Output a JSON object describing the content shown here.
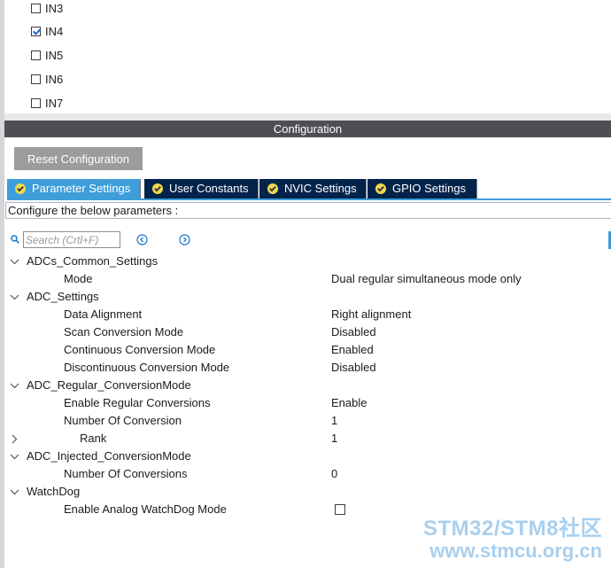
{
  "inputs_panel": {
    "items": [
      {
        "label": "IN3",
        "checked": false
      },
      {
        "label": "IN4",
        "checked": true
      },
      {
        "label": "IN5",
        "checked": false
      },
      {
        "label": "IN6",
        "checked": false
      },
      {
        "label": "IN7",
        "checked": false
      }
    ]
  },
  "config_header": {
    "title": "Configuration"
  },
  "toolbar": {
    "reset_label": "Reset Configuration"
  },
  "tabs": [
    {
      "label": "Parameter Settings",
      "active": true,
      "icon": "check-circle-icon"
    },
    {
      "label": "User Constants",
      "active": false,
      "icon": "check-circle-icon"
    },
    {
      "label": "NVIC Settings",
      "active": false,
      "icon": "check-circle-icon"
    },
    {
      "label": "GPIO Settings",
      "active": false,
      "icon": "check-circle-icon"
    }
  ],
  "configure_hint": "Configure the below parameters :",
  "search": {
    "placeholder": "Search (Crtl+F)",
    "value": ""
  },
  "tree": {
    "groups": [
      {
        "label": "ADCs_Common_Settings",
        "expanded": true,
        "params": [
          {
            "label": "Mode",
            "value": "Dual regular simultaneous mode only"
          }
        ]
      },
      {
        "label": "ADC_Settings",
        "expanded": true,
        "params": [
          {
            "label": "Data Alignment",
            "value": "Right alignment"
          },
          {
            "label": "Scan Conversion Mode",
            "value": "Disabled"
          },
          {
            "label": "Continuous Conversion Mode",
            "value": "Enabled"
          },
          {
            "label": "Discontinuous Conversion Mode",
            "value": "Disabled"
          }
        ]
      },
      {
        "label": "ADC_Regular_ConversionMode",
        "expanded": true,
        "params": [
          {
            "label": "Enable Regular Conversions",
            "value": "Enable"
          },
          {
            "label": "Number Of Conversion",
            "value": "1"
          },
          {
            "label": "Rank",
            "value": "1",
            "collapsed": true
          }
        ]
      },
      {
        "label": "ADC_Injected_ConversionMode",
        "expanded": true,
        "params": [
          {
            "label": "Number Of Conversions",
            "value": "0"
          }
        ]
      },
      {
        "label": "WatchDog",
        "expanded": true,
        "params": [
          {
            "label": "Enable Analog WatchDog Mode",
            "checked": false
          }
        ]
      }
    ]
  },
  "watermark": {
    "line1": "STM32/STM8社区",
    "line2": "www.stmcu.org.cn"
  },
  "colors": {
    "tab_active": "#3d9ed9",
    "tab_inactive": "#03234b",
    "header": "#4d4f53",
    "button": "#9c9c9c"
  }
}
